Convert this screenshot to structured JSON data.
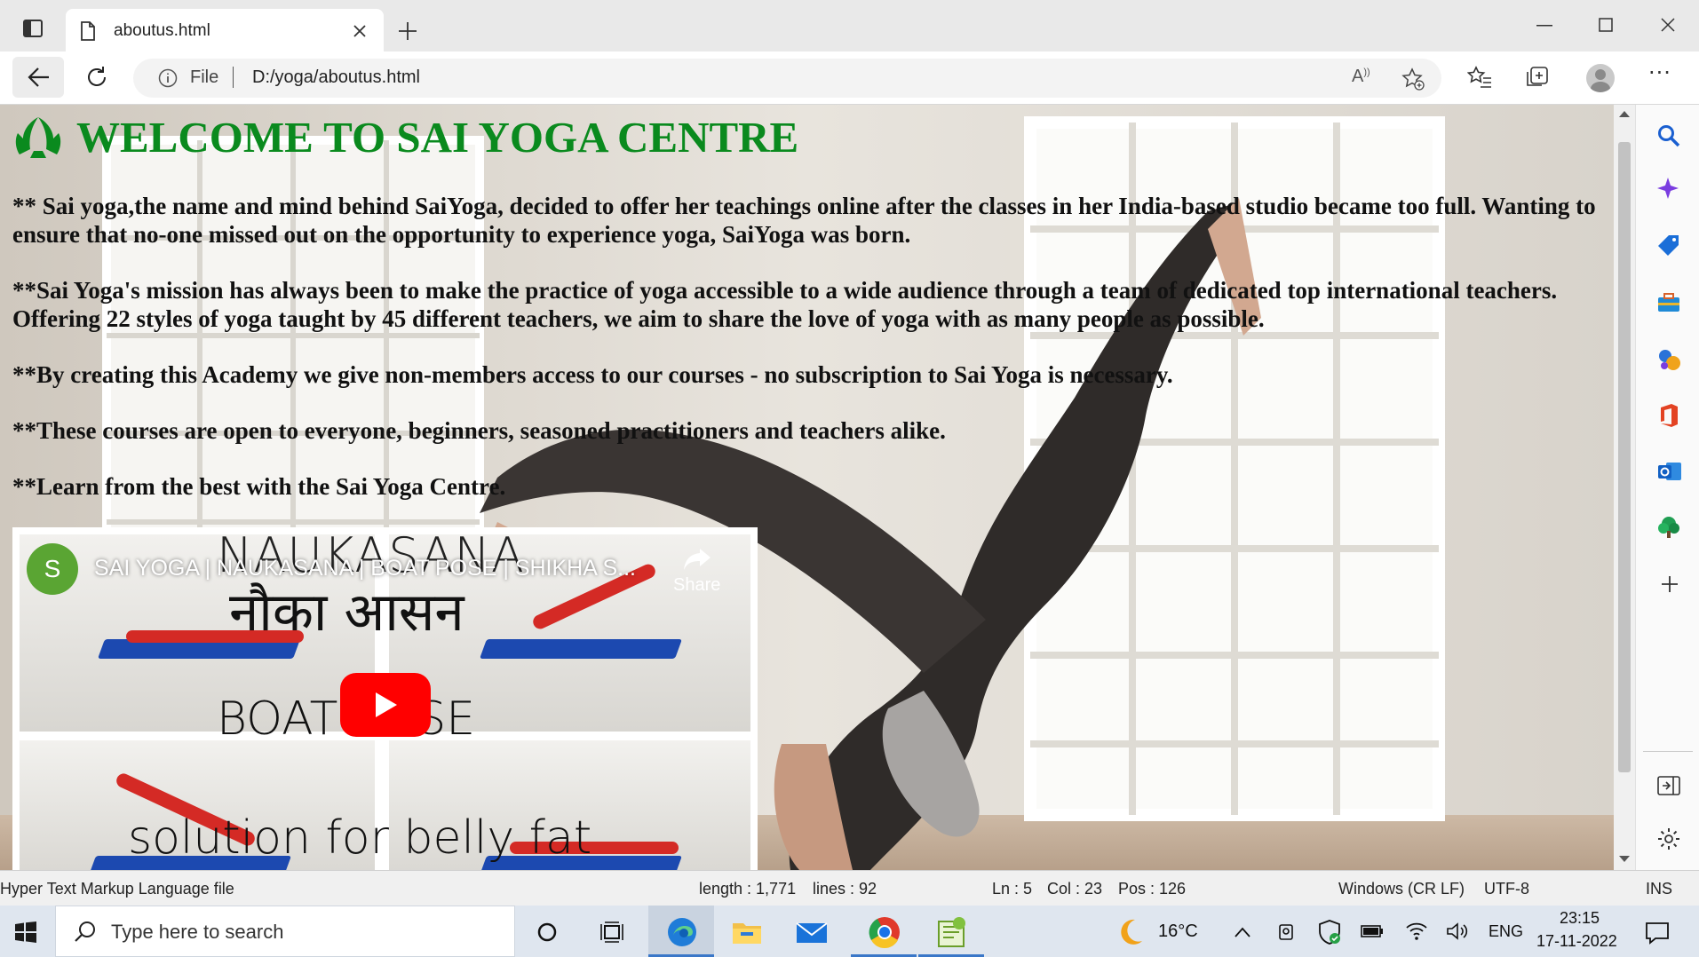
{
  "browser": {
    "tab_title": "aboutus.html",
    "address_prefix": "File",
    "address": "D:/yoga/aboutus.html"
  },
  "page": {
    "title": "WELCOME TO SAI YOGA CENTRE",
    "paragraphs": [
      "** Sai yoga,the name and mind behind SaiYoga, decided to offer her teachings online after the classes in her India-based studio became too full. Wanting to ensure that no-one missed out on the opportunity to experience yoga, SaiYoga was born.",
      "**Sai Yoga's mission has always been to make the practice of yoga accessible to a wide audience through a team of dedicated top international teachers. Offering 22 styles of yoga taught by 45 different teachers, we aim to share the love of yoga with as many people as possible.",
      "**By creating this Academy we give non-members access to our courses - no subscription to Sai Yoga is necessary.",
      "**These courses are open to everyone, beginners, seasoned practitioners and teachers alike.",
      "**Learn from the best with the Sai Yoga Centre."
    ],
    "video": {
      "channel_initial": "S",
      "title": "SAI YOGA | NAUKASANA | BOAT POSE | SHIKHA S...",
      "share_label": "Share",
      "thumb_top": "NAUKASANA",
      "thumb_hindi": "नौका आसन",
      "thumb_mid": "BOAT POSE",
      "thumb_bottom": "solution for belly fat"
    }
  },
  "statusbar": {
    "file_type": "Hyper Text Markup Language file",
    "length": "length : 1,771",
    "lines": "lines : 92",
    "ln": "Ln : 5",
    "col": "Col : 23",
    "pos": "Pos : 126",
    "eol": "Windows (CR LF)",
    "encoding": "UTF-8",
    "mode": "INS"
  },
  "taskbar": {
    "search_placeholder": "Type here to search",
    "temperature": "16°C",
    "language": "ENG",
    "time": "23:15",
    "date": "17-11-2022"
  },
  "colors": {
    "title_green": "#0a8a1e",
    "youtube_red": "#ff0000",
    "channel_avatar": "#5aa533"
  }
}
